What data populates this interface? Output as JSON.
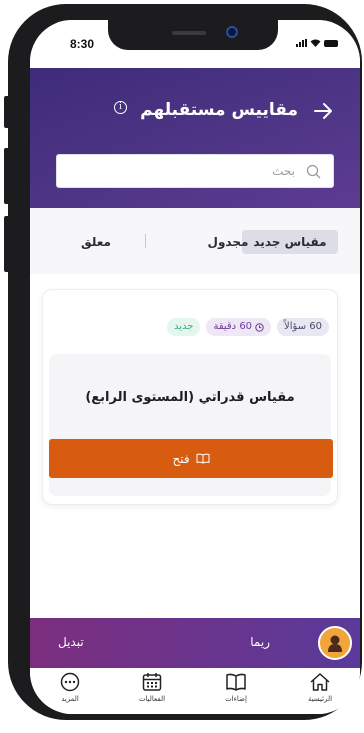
{
  "status_bar": {
    "time": "8:30"
  },
  "header": {
    "title": "مقاييس مستقبلهم"
  },
  "search": {
    "placeholder": "بحث"
  },
  "tabs": [
    {
      "label": "مقياس جديد",
      "active": true
    },
    {
      "label": "مجدول",
      "active": false
    },
    {
      "label": "معلق",
      "active": false
    }
  ],
  "card": {
    "badges": {
      "questions": "60 سؤالاً",
      "duration": "60 دقيقة",
      "status": "جديد"
    },
    "name": "مقياس قدراتي (المستوى الرابع)",
    "open_label": "فتح"
  },
  "user_bar": {
    "name": "ريما",
    "switch_label": "تبديل"
  },
  "nav": [
    {
      "label": "الرئيسية",
      "icon": "home-icon"
    },
    {
      "label": "إضاءات",
      "icon": "book-icon"
    },
    {
      "label": "الفعاليات",
      "icon": "calendar-icon"
    },
    {
      "label": "المزيد",
      "icon": "more-icon"
    }
  ],
  "colors": {
    "header": "#4a3385",
    "accent_button": "#d85c10",
    "user_bar": "#6a3489"
  }
}
